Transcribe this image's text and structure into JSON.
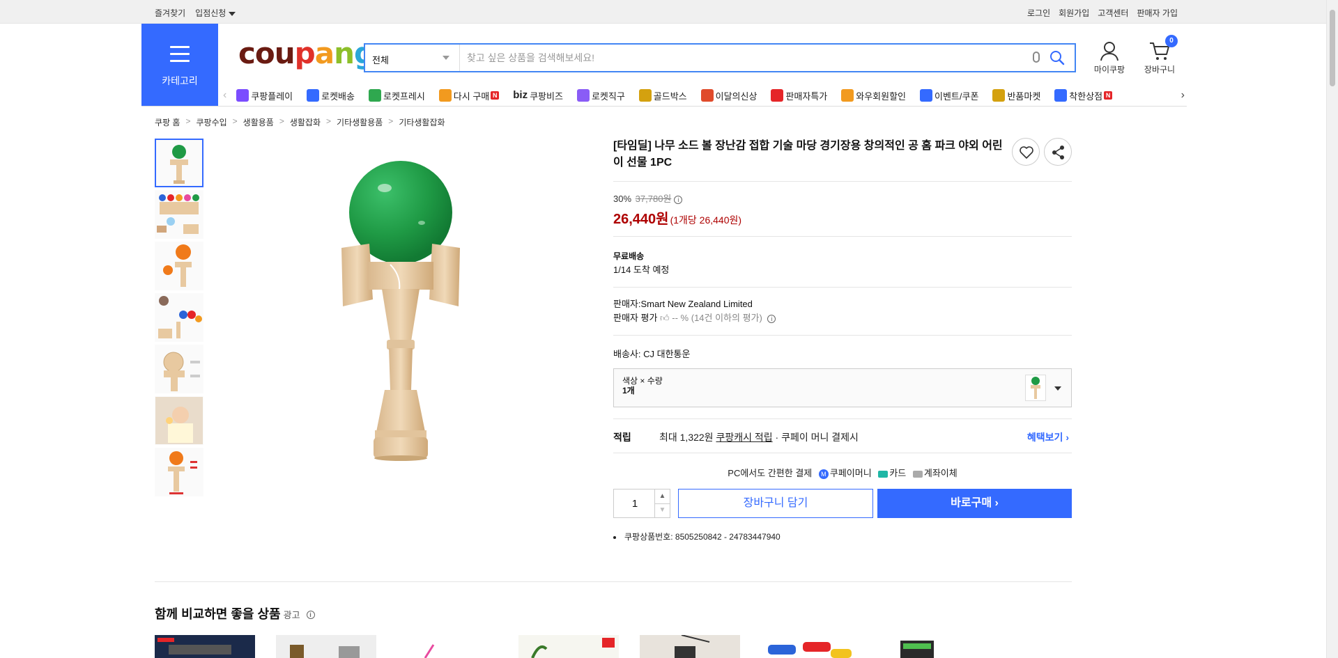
{
  "topbar": {
    "left": [
      "즐겨찾기",
      "입점신청"
    ],
    "right": [
      "로그인",
      "회원가입",
      "고객센터",
      "판매자 가입"
    ]
  },
  "header": {
    "category_label": "카테고리",
    "logo": [
      "cou",
      "p",
      "a",
      "n",
      "g"
    ],
    "search": {
      "category": "전체",
      "placeholder": "찾고 싶은 상품을 검색해보세요!"
    },
    "mycoupang_label": "마이쿠팡",
    "cart_label": "장바구니",
    "cart_count": "0"
  },
  "nav": [
    {
      "label": "쿠팡플레이",
      "icon": "play-icon",
      "color": "#7b4dff",
      "new": false
    },
    {
      "label": "로켓배송",
      "icon": "rocket-icon",
      "color": "#346aff",
      "new": false
    },
    {
      "label": "로켓프레시",
      "icon": "rocket-fresh-icon",
      "color": "#2fa84f",
      "new": false
    },
    {
      "label": "다시 구매",
      "icon": "rebuy-icon",
      "color": "#f29a1f",
      "new": true
    },
    {
      "label": "쿠팡비즈",
      "icon": "biz-icon",
      "color": "#222",
      "new": false,
      "prefix": "biz"
    },
    {
      "label": "로켓직구",
      "icon": "global-icon",
      "color": "#8a5cf6",
      "new": false
    },
    {
      "label": "골드박스",
      "icon": "goldbox-icon",
      "color": "#d4a10f",
      "new": false
    },
    {
      "label": "이달의신상",
      "icon": "new-arrival-icon",
      "color": "#e04b2b",
      "new": false
    },
    {
      "label": "판매자특가",
      "icon": "seller-deal-icon",
      "color": "#e52528",
      "new": false
    },
    {
      "label": "와우회원할인",
      "icon": "wow-icon",
      "color": "#f29a1f",
      "new": false
    },
    {
      "label": "이벤트/쿠폰",
      "icon": "coupon-icon",
      "color": "#346aff",
      "new": false
    },
    {
      "label": "반품마켓",
      "icon": "return-market-icon",
      "color": "#d4a10f",
      "new": false
    },
    {
      "label": "착한상점",
      "icon": "good-store-icon",
      "color": "#346aff",
      "new": true
    }
  ],
  "breadcrumb": [
    "쿠팡 홈",
    "쿠팡수입",
    "생활용품",
    "생활잡화",
    "기타생활용품",
    "기타생활잡화"
  ],
  "product": {
    "title": "[타임딜] 나무 소드 볼 장난감 접합 기술 마당 경기장용 창의적인 공 홈 파크 야외 어린이 선물 1PC",
    "discount": "30%",
    "original_price": "37,780원",
    "price": "26,440원",
    "unit_price": "(1개당 26,440원)",
    "shipping_title": "무료배송",
    "arrival": "1/14 도착 예정",
    "seller": "판매자:Smart New Zealand Limited",
    "seller_rating_label": "판매자 평가",
    "seller_rating_value": "-- %",
    "seller_rating_note": "(14건 이하의 평가)",
    "courier": "배송사:  CJ 대한통운",
    "option_label": "색상 × 수량",
    "option_value": "1개",
    "reward_label": "적립",
    "reward_prefix": "최대 1,322원",
    "reward_link": "쿠팡캐시 적립",
    "reward_suffix": "· 쿠페이 머니 결제시",
    "reward_more": "혜택보기",
    "pay_intro": "PC에서도 간편한 결제",
    "pay_methods": [
      "쿠페이머니",
      "카드",
      "계좌이체"
    ],
    "qty": "1",
    "cart_button": "장바구니 담기",
    "buy_button": "바로구매",
    "product_no": "쿠팡상품번호: 8505250842 - 24783447940"
  },
  "compare": {
    "title": "함께 비교하면 좋을 상품",
    "ad": "광고"
  },
  "colors": {
    "accent": "#346aff",
    "price": "#ae0000",
    "ball": "#1f9a45",
    "wood": "#e8c9a0"
  }
}
